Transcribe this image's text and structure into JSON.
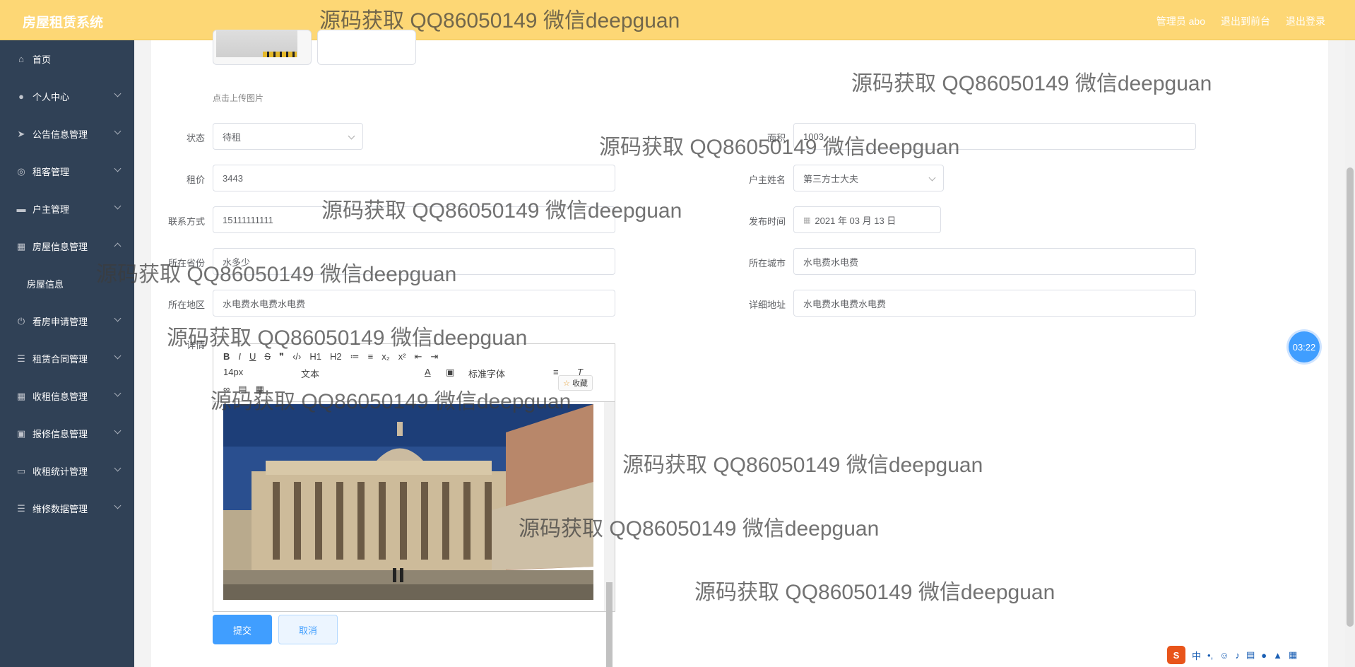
{
  "header": {
    "brand": "房屋租赁系统",
    "admin": "管理员 abo",
    "back_front": "退出到前台",
    "logout": "退出登录"
  },
  "sidebar": {
    "items": [
      {
        "label": "首页"
      },
      {
        "label": "个人中心"
      },
      {
        "label": "公告信息管理"
      },
      {
        "label": "租客管理"
      },
      {
        "label": "户主管理"
      },
      {
        "label": "房屋信息管理"
      },
      {
        "label": "房屋信息"
      },
      {
        "label": "看房申请管理"
      },
      {
        "label": "租赁合同管理"
      },
      {
        "label": "收租信息管理"
      },
      {
        "label": "报修信息管理"
      },
      {
        "label": "收租统计管理"
      },
      {
        "label": "维修数据管理"
      }
    ]
  },
  "form": {
    "upload_hint": "点击上传图片",
    "status_label": "状态",
    "status_value": "待租",
    "area_label": "面积",
    "area_value": "1003",
    "rent_label": "租价",
    "rent_value": "3443",
    "owner_label": "户主姓名",
    "owner_value": "第三方士大夫",
    "contact_label": "联系方式",
    "contact_value": "15111111111",
    "publish_label": "发布时间",
    "publish_value": "2021 年 03 月 13 日",
    "province_label": "所在省份",
    "province_value": "水多少",
    "city_label": "所在城市",
    "city_value": "水电费水电费",
    "district_label": "所在地区",
    "district_value": "水电费水电费水电费",
    "address_label": "详细地址",
    "address_value": "水电费水电费水电费",
    "detail_label": "详情"
  },
  "editor": {
    "row1": [
      "B",
      "I",
      "U",
      "S",
      "❞",
      "‹/›",
      "H1",
      "H2",
      "≔",
      "≡",
      "x₂",
      "x²",
      "⇤",
      "⇥"
    ],
    "font_size": "14px",
    "text_type": "文本",
    "font_family": "标准字体",
    "favorite": "收藏"
  },
  "buttons": {
    "submit": "提交",
    "cancel": "取消"
  },
  "timer": "03:22",
  "ime": {
    "lang": "中"
  },
  "watermark": "源码获取 QQ86050149 微信deepguan",
  "colors": {
    "header_bg": "#fdd775",
    "sidebar_bg": "#304156",
    "primary": "#409eff"
  }
}
